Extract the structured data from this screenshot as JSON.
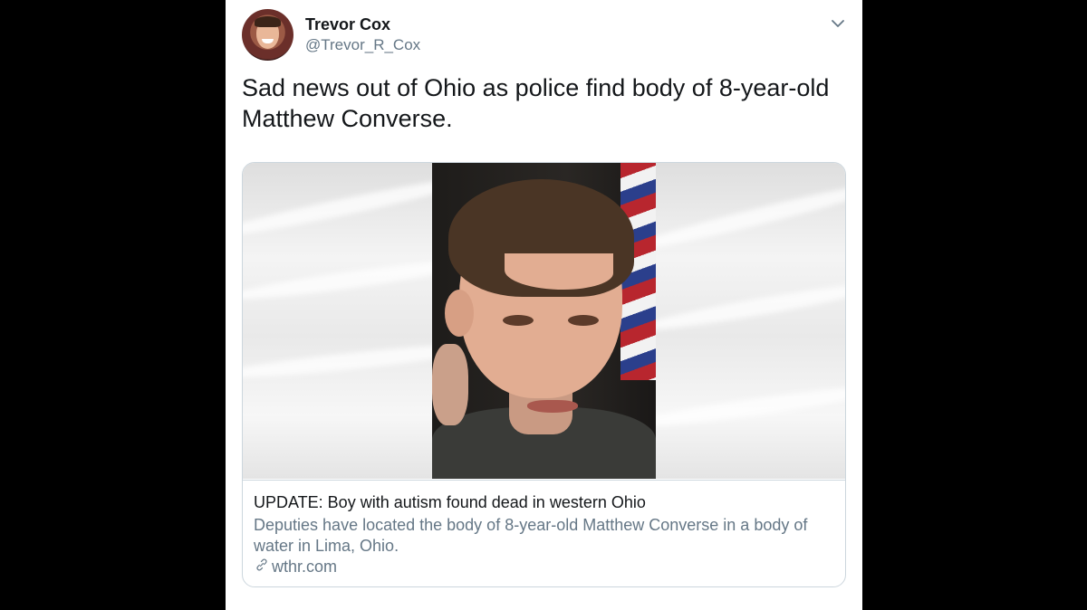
{
  "tweet": {
    "author_name": "Trevor Cox",
    "author_handle": "@Trevor_R_Cox",
    "text": "Sad news out of Ohio as police find body of 8-year-old Matthew Converse.",
    "menu_icon": "chevron-down-icon"
  },
  "card": {
    "title": "UPDATE: Boy with autism found dead in western Ohio",
    "description": "Deputies have located the body of 8-year-old Matthew Converse in a body of water in Lima, Ohio.",
    "domain": "wthr.com",
    "domain_icon": "link-icon"
  },
  "colors": {
    "text_primary": "#14171a",
    "text_secondary": "#657786",
    "border": "#ccd6dd",
    "background": "#000000"
  }
}
